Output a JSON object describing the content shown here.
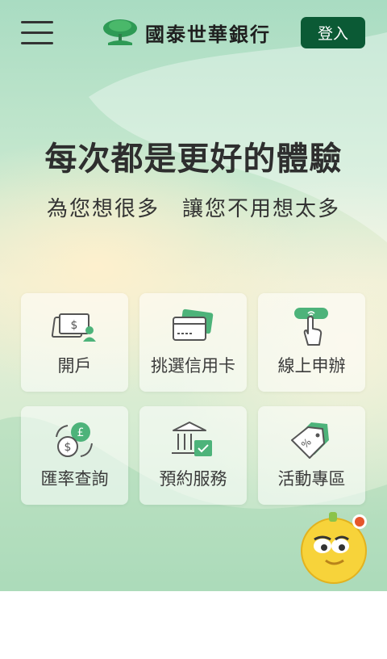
{
  "header": {
    "bank_name": "國泰世華銀行",
    "login_label": "登入"
  },
  "hero": {
    "headline": "每次都是更好的體驗",
    "subline": "為您想很多　讓您不用想太多"
  },
  "services": [
    {
      "label": "開戶",
      "icon": "open-account-icon"
    },
    {
      "label": "挑選信用卡",
      "icon": "credit-card-icon"
    },
    {
      "label": "線上申辦",
      "icon": "tap-apply-icon"
    },
    {
      "label": "匯率查詢",
      "icon": "exchange-rate-icon"
    },
    {
      "label": "預約服務",
      "icon": "bank-appointment-icon"
    },
    {
      "label": "活動專區",
      "icon": "discount-tag-icon"
    }
  ],
  "colors": {
    "brand_green": "#0b5a35",
    "icon_green": "#4db37a"
  }
}
